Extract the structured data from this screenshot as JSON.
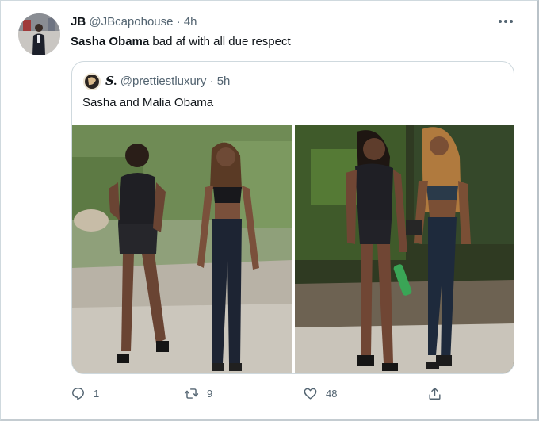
{
  "tweet": {
    "display_name": "JB",
    "handle": "@JBcapohouse",
    "separator": "·",
    "time": "4h",
    "text_bold": "Sasha Obama",
    "text_rest": " bad af with all due respect",
    "more_icon": "more-dots-icon",
    "avatar_icon": "profile-photo"
  },
  "quote": {
    "display_name": "𝑺.",
    "handle": "@prettiestluxury",
    "separator": "·",
    "time": "5h",
    "text": "Sasha and Malia Obama",
    "media": [
      {
        "name": "photo-walking-trail-1",
        "description_icon": "photo"
      },
      {
        "name": "photo-walking-trail-2",
        "description_icon": "photo"
      }
    ]
  },
  "actions": {
    "reply": {
      "icon": "reply-icon",
      "count": "1"
    },
    "retweet": {
      "icon": "retweet-icon",
      "count": "9"
    },
    "like": {
      "icon": "heart-icon",
      "count": "48"
    },
    "share": {
      "icon": "share-icon",
      "count": ""
    }
  },
  "colors": {
    "text": "#0f1419",
    "secondary": "#536471",
    "border": "#cfd9de"
  }
}
